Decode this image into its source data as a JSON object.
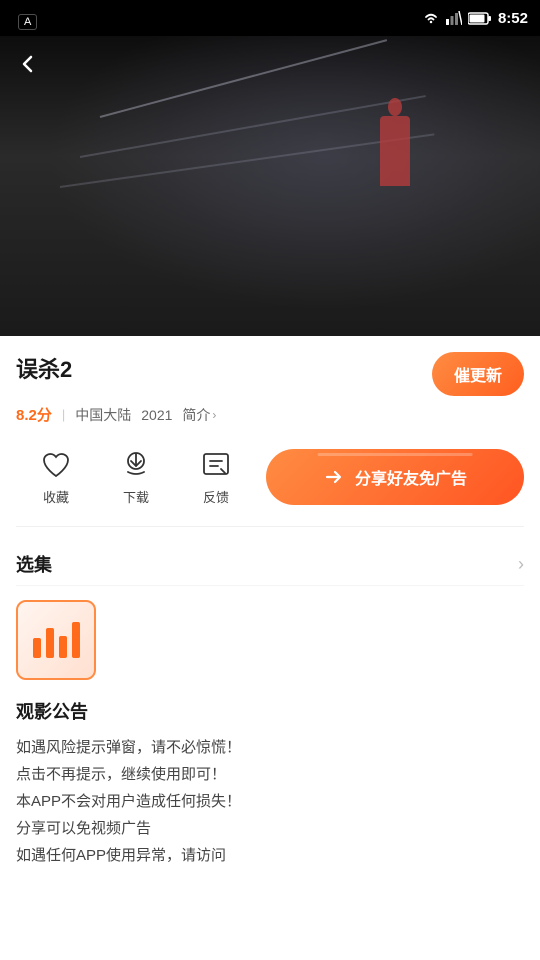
{
  "statusBar": {
    "time": "8:52",
    "appLabel": "A"
  },
  "video": {
    "backIcon": "‹"
  },
  "movie": {
    "title": "误杀2",
    "score": "8.2分",
    "divider": "|",
    "region": "中国大陆",
    "year": "2021",
    "introLabel": "简介",
    "updateBtn": "催更新"
  },
  "actions": [
    {
      "icon": "♡",
      "label": "收藏"
    },
    {
      "icon": "⬇",
      "label": "下载"
    },
    {
      "icon": "✎",
      "label": "反馈"
    }
  ],
  "shareAd": {
    "text": "分享好友免广告"
  },
  "episodeSection": {
    "title": "选集",
    "chevron": "›"
  },
  "announcement": {
    "title": "观影公告",
    "lines": [
      "如遇风险提示弹窗，请不必惊慌！",
      "点击不再提示，继续使用即可！",
      "本APP不会对用户造成任何损失！",
      "分享可以免视频广告",
      "如遇任何APP使用异常，请访问"
    ]
  }
}
